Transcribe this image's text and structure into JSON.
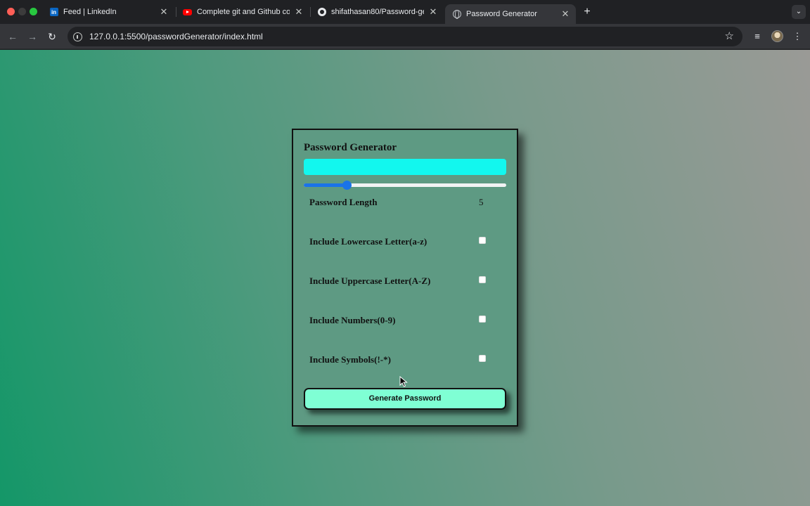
{
  "browser": {
    "tabs": [
      {
        "title": "Feed | LinkedIn",
        "favicon": "linkedin-icon",
        "active": false
      },
      {
        "title": "Complete git and Github cou",
        "favicon": "youtube-icon",
        "active": false
      },
      {
        "title": "shifathasan80/Password-gen",
        "favicon": "github-icon",
        "active": false
      },
      {
        "title": "Password Generator",
        "favicon": "globe-icon",
        "active": true
      }
    ],
    "new_tab_glyph": "+",
    "close_glyph": "✕",
    "tab_menu_glyph": "⌄",
    "url": "127.0.0.1:5500/passwordGenerator/index.html",
    "linkedin_mark": "in"
  },
  "toolbar_glyphs": {
    "back": "←",
    "forward": "→",
    "reload": "↻",
    "star": "☆",
    "media": "≡",
    "menu": "⋮"
  },
  "app": {
    "title": "Password Generator",
    "password_value": "",
    "slider": {
      "min": 1,
      "max": 20,
      "value": 5
    },
    "length_label": "Password Length",
    "length_value": "5",
    "options": [
      {
        "label": "Include Lowercase Letter(a-z)",
        "checked": false
      },
      {
        "label": "Include Uppercase Letter(A-Z)",
        "checked": false
      },
      {
        "label": "Include Numbers(0-9)",
        "checked": false
      },
      {
        "label": "Include Symbols(!-*)",
        "checked": false
      }
    ],
    "generate_label": "Generate Password"
  },
  "colors": {
    "display_bg": "#12f7ee",
    "button_bg": "#7fffd4",
    "slider_accent": "#1a73e8"
  }
}
